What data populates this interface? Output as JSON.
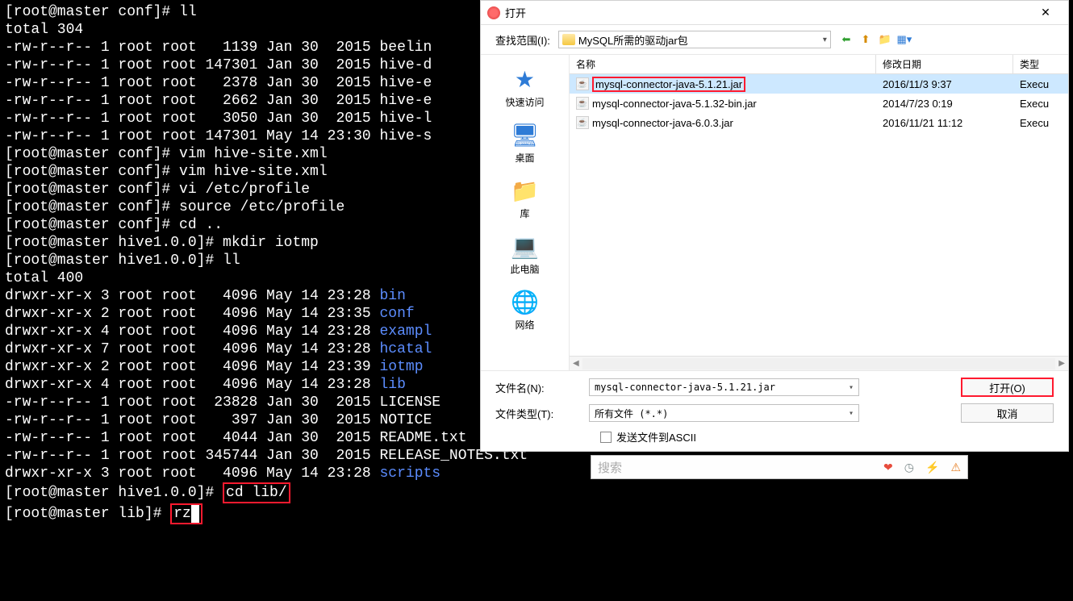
{
  "terminal": {
    "lines": [
      {
        "text": "[root@master conf]# ll"
      },
      {
        "text": "total 304"
      },
      {
        "text": "-rw-r--r-- 1 root root   1139 Jan 30  2015 beelin"
      },
      {
        "text": "-rw-r--r-- 1 root root 147301 Jan 30  2015 hive-d"
      },
      {
        "text": "-rw-r--r-- 1 root root   2378 Jan 30  2015 hive-e"
      },
      {
        "text": "-rw-r--r-- 1 root root   2662 Jan 30  2015 hive-e"
      },
      {
        "text": "-rw-r--r-- 1 root root   3050 Jan 30  2015 hive-l"
      },
      {
        "text": "-rw-r--r-- 1 root root 147301 May 14 23:30 hive-s"
      },
      {
        "text": "[root@master conf]# vim hive-site.xml"
      },
      {
        "text": "[root@master conf]# vim hive-site.xml"
      },
      {
        "text": "[root@master conf]# vi /etc/profile"
      },
      {
        "text": "[root@master conf]# source /etc/profile"
      },
      {
        "text": "[root@master conf]# cd .."
      },
      {
        "text": "[root@master hive1.0.0]# mkdir iotmp"
      },
      {
        "text": "[root@master hive1.0.0]# ll"
      },
      {
        "text": "total 400"
      },
      {
        "pre": "drwxr-xr-x 3 root root   4096 May 14 23:28 ",
        "dir": "bin"
      },
      {
        "pre": "drwxr-xr-x 2 root root   4096 May 14 23:35 ",
        "dir": "conf"
      },
      {
        "pre": "drwxr-xr-x 4 root root   4096 May 14 23:28 ",
        "dir": "exampl"
      },
      {
        "pre": "drwxr-xr-x 7 root root   4096 May 14 23:28 ",
        "dir": "hcatal"
      },
      {
        "pre": "drwxr-xr-x 2 root root   4096 May 14 23:39 ",
        "dir": "iotmp"
      },
      {
        "pre": "drwxr-xr-x 4 root root   4096 May 14 23:28 ",
        "dir": "lib"
      },
      {
        "text": "-rw-r--r-- 1 root root  23828 Jan 30  2015 LICENSE"
      },
      {
        "text": "-rw-r--r-- 1 root root    397 Jan 30  2015 NOTICE"
      },
      {
        "text": "-rw-r--r-- 1 root root   4044 Jan 30  2015 README.txt"
      },
      {
        "text": "-rw-r--r-- 1 root root 345744 Jan 30  2015 RELEASE_NOTES.txt"
      },
      {
        "pre": "drwxr-xr-x 3 root root   4096 May 14 23:28 ",
        "dir": "scripts"
      }
    ],
    "highlight_cd_prompt": "[root@master hive1.0.0]# ",
    "highlight_cd_cmd": "cd lib/",
    "highlight_rz_prompt": "[root@master lib]# ",
    "highlight_rz_cmd": "rz"
  },
  "dialog": {
    "title": "打开",
    "lookup_label": "查找范围(I):",
    "lookup_value": "MySQL所需的驱动jar包",
    "places": [
      {
        "name": "quick-access",
        "label": "快速访问",
        "icon": "★",
        "color": "#2e7bd6"
      },
      {
        "name": "desktop",
        "label": "桌面",
        "icon": "🖥",
        "color": "#2e7bd6"
      },
      {
        "name": "libraries",
        "label": "库",
        "icon": "📁",
        "color": "#f5b942"
      },
      {
        "name": "this-pc",
        "label": "此电脑",
        "icon": "💻",
        "color": "#5a7a8c"
      },
      {
        "name": "network",
        "label": "网络",
        "icon": "🌐",
        "color": "#2e7bd6"
      }
    ],
    "columns": {
      "name": "名称",
      "date": "修改日期",
      "type": "类型"
    },
    "files": [
      {
        "name": "mysql-connector-java-5.1.21.jar",
        "date": "2016/11/3 9:37",
        "type": "Execu",
        "selected": true
      },
      {
        "name": "mysql-connector-java-5.1.32-bin.jar",
        "date": "2014/7/23 0:19",
        "type": "Execu",
        "selected": false
      },
      {
        "name": "mysql-connector-java-6.0.3.jar",
        "date": "2016/11/21 11:12",
        "type": "Execu",
        "selected": false
      }
    ],
    "filename_label": "文件名(N):",
    "filename_value": "mysql-connector-java-5.1.21.jar",
    "filetype_label": "文件类型(T):",
    "filetype_value": "所有文件 (*.*)",
    "open_btn": "打开(O)",
    "cancel_btn": "取消",
    "checkbox_label": "发送文件到ASCII"
  },
  "search": {
    "placeholder": "搜索"
  }
}
